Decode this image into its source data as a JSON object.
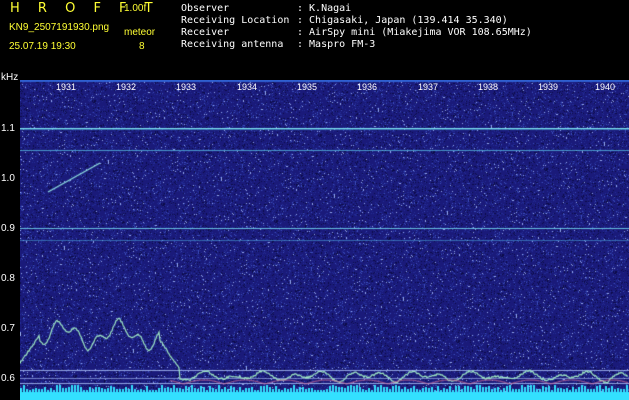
{
  "header": {
    "app_title": "H R O F F T",
    "version": "1.00f",
    "filename": "KN9_2507191930.png",
    "meteor_label": "meteor",
    "timestamp": "25.07.19 19:30",
    "meteor_count": "8"
  },
  "info": [
    {
      "key": "Observer",
      "value": ": K.Nagai"
    },
    {
      "key": "Receiving Location",
      "value": ": Chigasaki, Japan (139.414 35.340)"
    },
    {
      "key": "Receiver",
      "value": ": AirSpy mini (Miakejima VOR 108.65MHz)"
    },
    {
      "key": "Receiving antenna",
      "value": ": Maspro FM-3"
    }
  ],
  "axis": {
    "unit": "kHz",
    "y_ticks": [
      "1.1",
      "1.0",
      "0.9",
      "0.8",
      "0.7",
      "0.6"
    ],
    "x_ticks": [
      "1931",
      "1932",
      "1933",
      "1934",
      "1935",
      "1936",
      "1937",
      "1938",
      "1939",
      "1940"
    ]
  },
  "colors": {
    "background": "#1a1a7a",
    "header_text": "#ffff33",
    "info_text": "#ffffff",
    "trace": "#9fe8c4",
    "signal_line": "#66d8e8",
    "baseline": "#33e0ff"
  }
}
